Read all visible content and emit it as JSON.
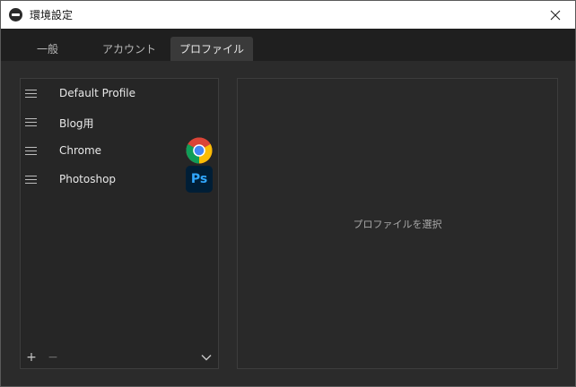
{
  "window": {
    "title": "環境設定",
    "icons": {
      "app": "app-logo-icon",
      "close": "close-icon"
    }
  },
  "tabs": [
    {
      "label": "一般",
      "active": false
    },
    {
      "label": "アカウント",
      "active": false
    },
    {
      "label": "プロファイル",
      "active": true
    }
  ],
  "profiles": {
    "items": [
      {
        "label": "Default Profile",
        "icon": ""
      },
      {
        "label": "Blog用",
        "icon": ""
      },
      {
        "label": "Chrome",
        "icon": "chrome-icon"
      },
      {
        "label": "Photoshop",
        "icon": "photoshop-icon",
        "icon_text": "Ps"
      }
    ],
    "add_label": "+",
    "remove_label": "−"
  },
  "detail": {
    "placeholder": "プロファイルを選択"
  },
  "colors": {
    "accent_photoshop_bg": "#001e36",
    "accent_photoshop_fg": "#31a8ff"
  }
}
